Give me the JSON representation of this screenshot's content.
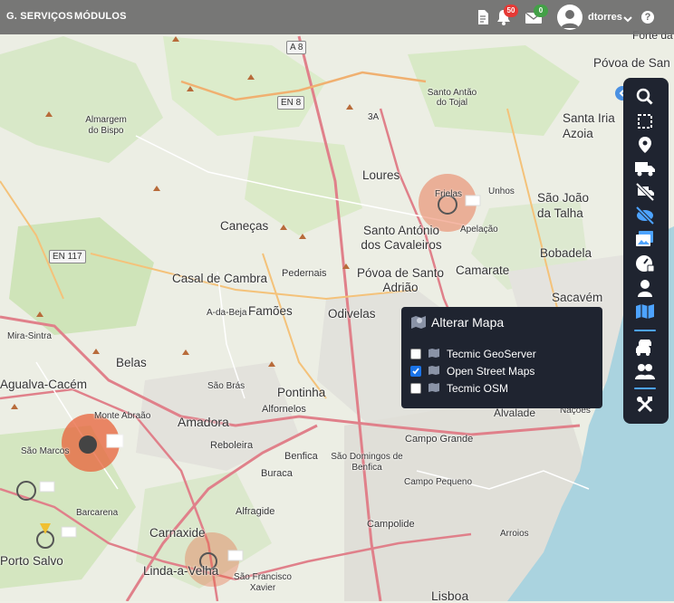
{
  "header": {
    "menu_items": [
      "G. SERVIÇOS",
      "MÓDULOS"
    ],
    "notifications_count": "50",
    "messages_count": "0",
    "username": "dtorres"
  },
  "toolbar": {
    "icons": [
      "search-icon",
      "select-area-icon",
      "location-pin-icon",
      "truck-icon",
      "hide-vehicles-icon",
      "hide-poi-icon",
      "gallery-icon",
      "dashboard-gauge-icon",
      "user-icon",
      "map-layers-icon",
      "car-group-icon",
      "users-icon",
      "tools-icon"
    ],
    "accent": "#4da3ff"
  },
  "map_popup": {
    "title": "Alterar Mapa",
    "options": [
      {
        "label": "Tecmic GeoServer",
        "checked": false
      },
      {
        "label": "Open Street Maps",
        "checked": true
      },
      {
        "label": "Tecmic OSM",
        "checked": false
      }
    ]
  },
  "map": {
    "places": [
      "Forte da",
      "Póvoa de San",
      "A 8",
      "Santo Antão do Tojal",
      "Almargem do Bispo",
      "EN 8",
      "3A",
      "Santa Iria Azoia",
      "Loures",
      "Frielas",
      "Unhos",
      "São João da Talha",
      "Caneças",
      "Santo António dos Cavaleiros",
      "Apelação",
      "Bobadela",
      "EN 117",
      "Casal de Cambra",
      "Pedernais",
      "Póvoa de Santo Adrião",
      "Camarate",
      "Sacavém",
      "A-da-Beja",
      "Famões",
      "Odivelas",
      "Mira-Sintra",
      "Belas",
      "Agualva-Cacém",
      "Monte Abraão",
      "São Brás",
      "Pontinha",
      "Alfornelos",
      "Amadora",
      "Reboleira",
      "Benfica",
      "São Domingos de Benfica",
      "Campo Grande",
      "Alvalade",
      "Nações",
      "São Marcos",
      "Buraca",
      "Campo Pequeno",
      "Barcarena",
      "Alfragide",
      "Campolide",
      "Arroios",
      "Porto Salvo",
      "Carnaxide",
      "Linda-a-Velha",
      "São Francisco Xavier",
      "Lisboa"
    ]
  },
  "colors": {
    "topbar": "#6e6e6e",
    "panel": "#1f2430",
    "accent": "#4a90e2",
    "cluster": "#e8623a"
  }
}
